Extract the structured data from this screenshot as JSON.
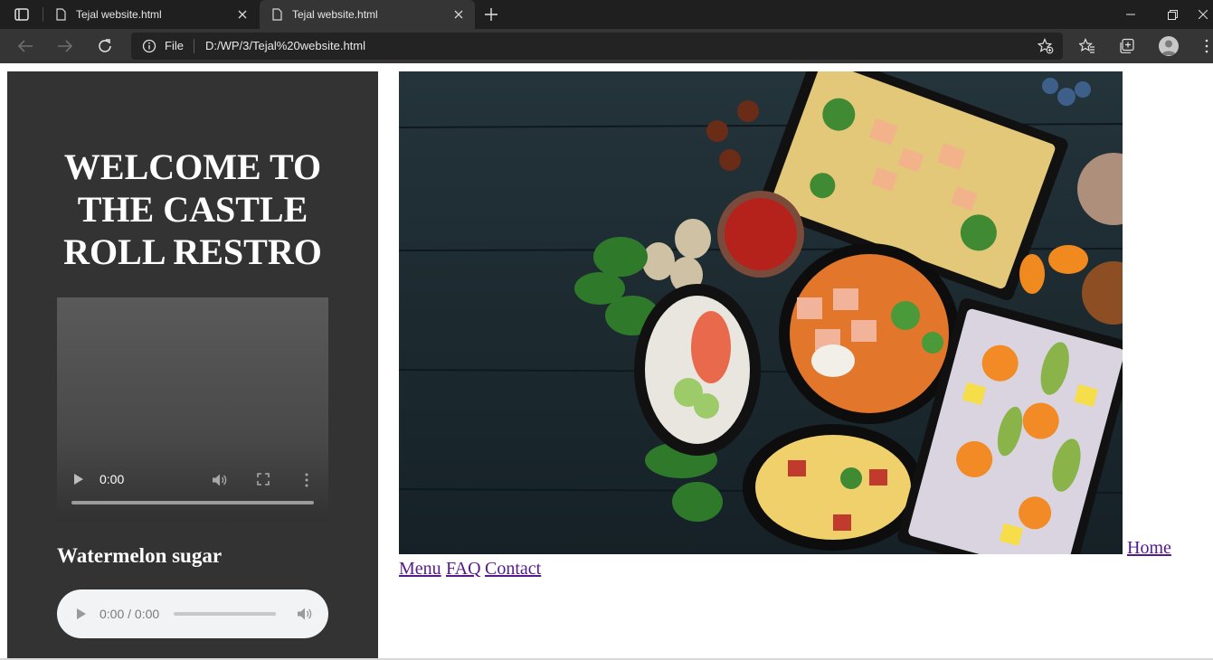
{
  "browser": {
    "tabs": [
      {
        "title": "Tejal website.html",
        "active": false
      },
      {
        "title": "Tejal website.html",
        "active": true
      }
    ],
    "address": {
      "scheme_label": "File",
      "url": "D:/WP/3/Tejal%20website.html"
    },
    "icons": [
      "tab-actions-icon",
      "new-tab-icon",
      "back-icon",
      "forward-icon",
      "reload-icon",
      "site-info-icon",
      "add-favorite-icon",
      "favorites-icon",
      "collections-icon",
      "profile-icon"
    ],
    "colors": {
      "tabbar": "#1f1f1f",
      "toolbar": "#353535",
      "omnibox": "#232323"
    }
  },
  "page": {
    "heading": "WELCOME TO THE CASTLE ROLL RESTRO",
    "video": {
      "time": "0:00"
    },
    "song_title": "Watermelon sugar",
    "audio": {
      "time": "0:00 / 0:00"
    },
    "nav": {
      "home": "Home",
      "menu": "Menu",
      "faq": "FAQ",
      "contact": "Contact"
    },
    "colors": {
      "sidebar": "#333333",
      "heading_text": "#ffffff",
      "link": "#551a8b"
    }
  }
}
